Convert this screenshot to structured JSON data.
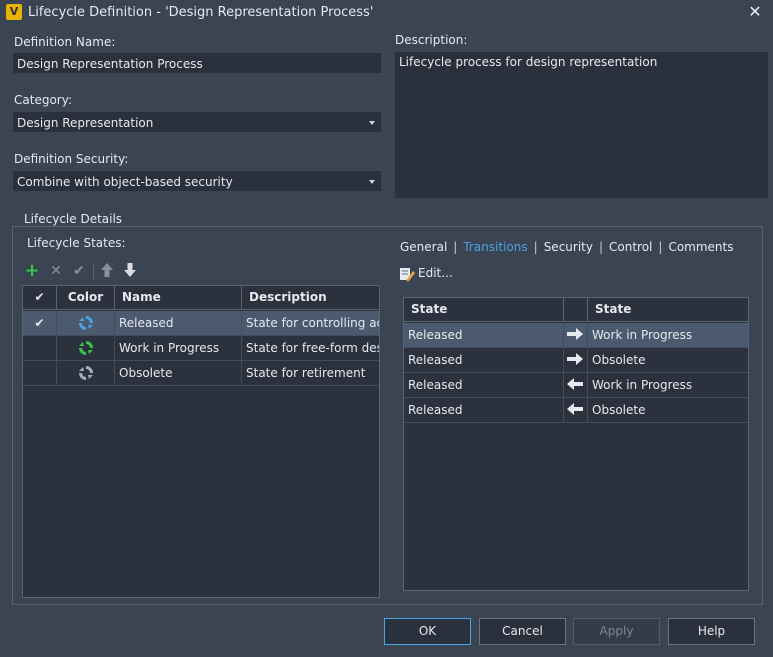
{
  "window": {
    "title": "Lifecycle Definition - 'Design Representation Process'",
    "app_icon_letter": "V"
  },
  "form": {
    "definition_name_label": "Definition Name:",
    "definition_name_value": "Design Representation Process",
    "category_label": "Category:",
    "category_value": "Design Representation",
    "security_label": "Definition Security:",
    "security_value": "Combine with object-based security",
    "description_label": "Description:",
    "description_value": "Lifecycle process for design representation"
  },
  "details": {
    "group_label": "Lifecycle Details",
    "states_label": "Lifecycle States:",
    "columns": {
      "check": "✔",
      "color": "Color",
      "name": "Name",
      "description": "Description"
    },
    "states": [
      {
        "checked": "✔",
        "name": "Released",
        "description": "State for controlling ac...",
        "icon_color": "#4aa3df"
      },
      {
        "checked": "",
        "name": "Work in Progress",
        "description": "State for free-form des...",
        "icon_color": "#3cc24a"
      },
      {
        "checked": "",
        "name": "Obsolete",
        "description": "State for retirement",
        "icon_color": "#a7adb6"
      }
    ]
  },
  "tabs": [
    {
      "label": "General",
      "active": false
    },
    {
      "label": "Transitions",
      "active": true
    },
    {
      "label": "Security",
      "active": false
    },
    {
      "label": "Control",
      "active": false
    },
    {
      "label": "Comments",
      "active": false
    }
  ],
  "transitions": {
    "edit_label": "Edit...",
    "columns": {
      "from": "State",
      "to": "State"
    },
    "rows": [
      {
        "from": "Released",
        "direction": "right",
        "to": "Work in Progress"
      },
      {
        "from": "Released",
        "direction": "right",
        "to": "Obsolete"
      },
      {
        "from": "Released",
        "direction": "left",
        "to": "Work in Progress"
      },
      {
        "from": "Released",
        "direction": "left",
        "to": "Obsolete"
      }
    ]
  },
  "buttons": {
    "ok": "OK",
    "cancel": "Cancel",
    "apply": "Apply",
    "help": "Help"
  },
  "colors": {
    "accent": "#4aa3df",
    "add_green": "#3cc24a",
    "background": "#3b4453"
  }
}
